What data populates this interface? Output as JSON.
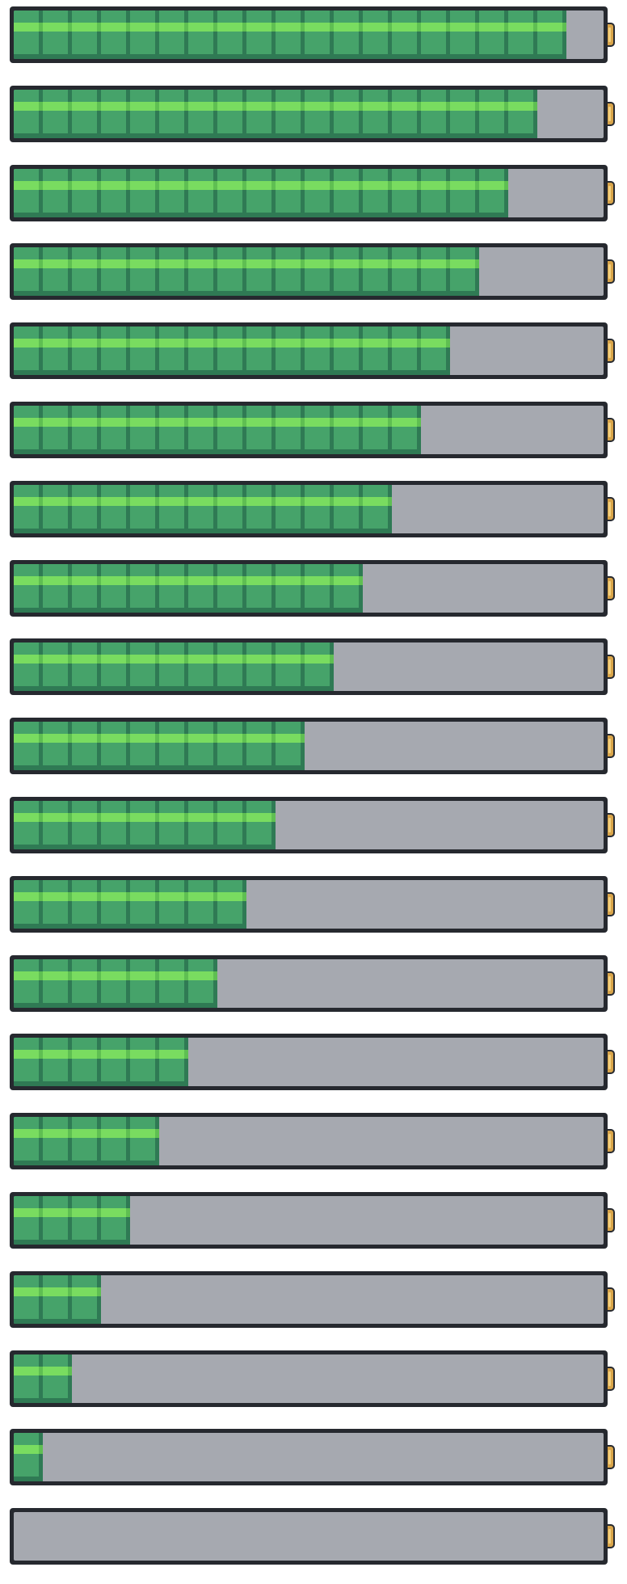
{
  "battery_bars": {
    "segment_total": 19,
    "levels": [
      {
        "filled_segments": 19,
        "fill_fraction": 1.0
      },
      {
        "filled_segments": 18,
        "fill_fraction": 0.947
      },
      {
        "filled_segments": 17,
        "fill_fraction": 0.895
      },
      {
        "filled_segments": 16,
        "fill_fraction": 0.842
      },
      {
        "filled_segments": 15,
        "fill_fraction": 0.789
      },
      {
        "filled_segments": 14,
        "fill_fraction": 0.737
      },
      {
        "filled_segments": 13,
        "fill_fraction": 0.684
      },
      {
        "filled_segments": 12,
        "fill_fraction": 0.632
      },
      {
        "filled_segments": 11,
        "fill_fraction": 0.579
      },
      {
        "filled_segments": 10,
        "fill_fraction": 0.526
      },
      {
        "filled_segments": 9,
        "fill_fraction": 0.474
      },
      {
        "filled_segments": 8,
        "fill_fraction": 0.421
      },
      {
        "filled_segments": 7,
        "fill_fraction": 0.368
      },
      {
        "filled_segments": 6,
        "fill_fraction": 0.316
      },
      {
        "filled_segments": 5,
        "fill_fraction": 0.263
      },
      {
        "filled_segments": 4,
        "fill_fraction": 0.211
      },
      {
        "filled_segments": 3,
        "fill_fraction": 0.158
      },
      {
        "filled_segments": 2,
        "fill_fraction": 0.105
      },
      {
        "filled_segments": 1,
        "fill_fraction": 0.053
      },
      {
        "filled_segments": 0,
        "fill_fraction": 0.0
      }
    ]
  },
  "colors": {
    "frame": "#26292f",
    "empty": "#a6a9b0",
    "cell": "#46a36a",
    "cell_highlight": "#79dc60",
    "cell_shadow": "#2f7a54",
    "terminal": "#d9a54a"
  },
  "icons": {
    "battery": "battery-icon",
    "terminal": "battery-terminal-icon"
  }
}
